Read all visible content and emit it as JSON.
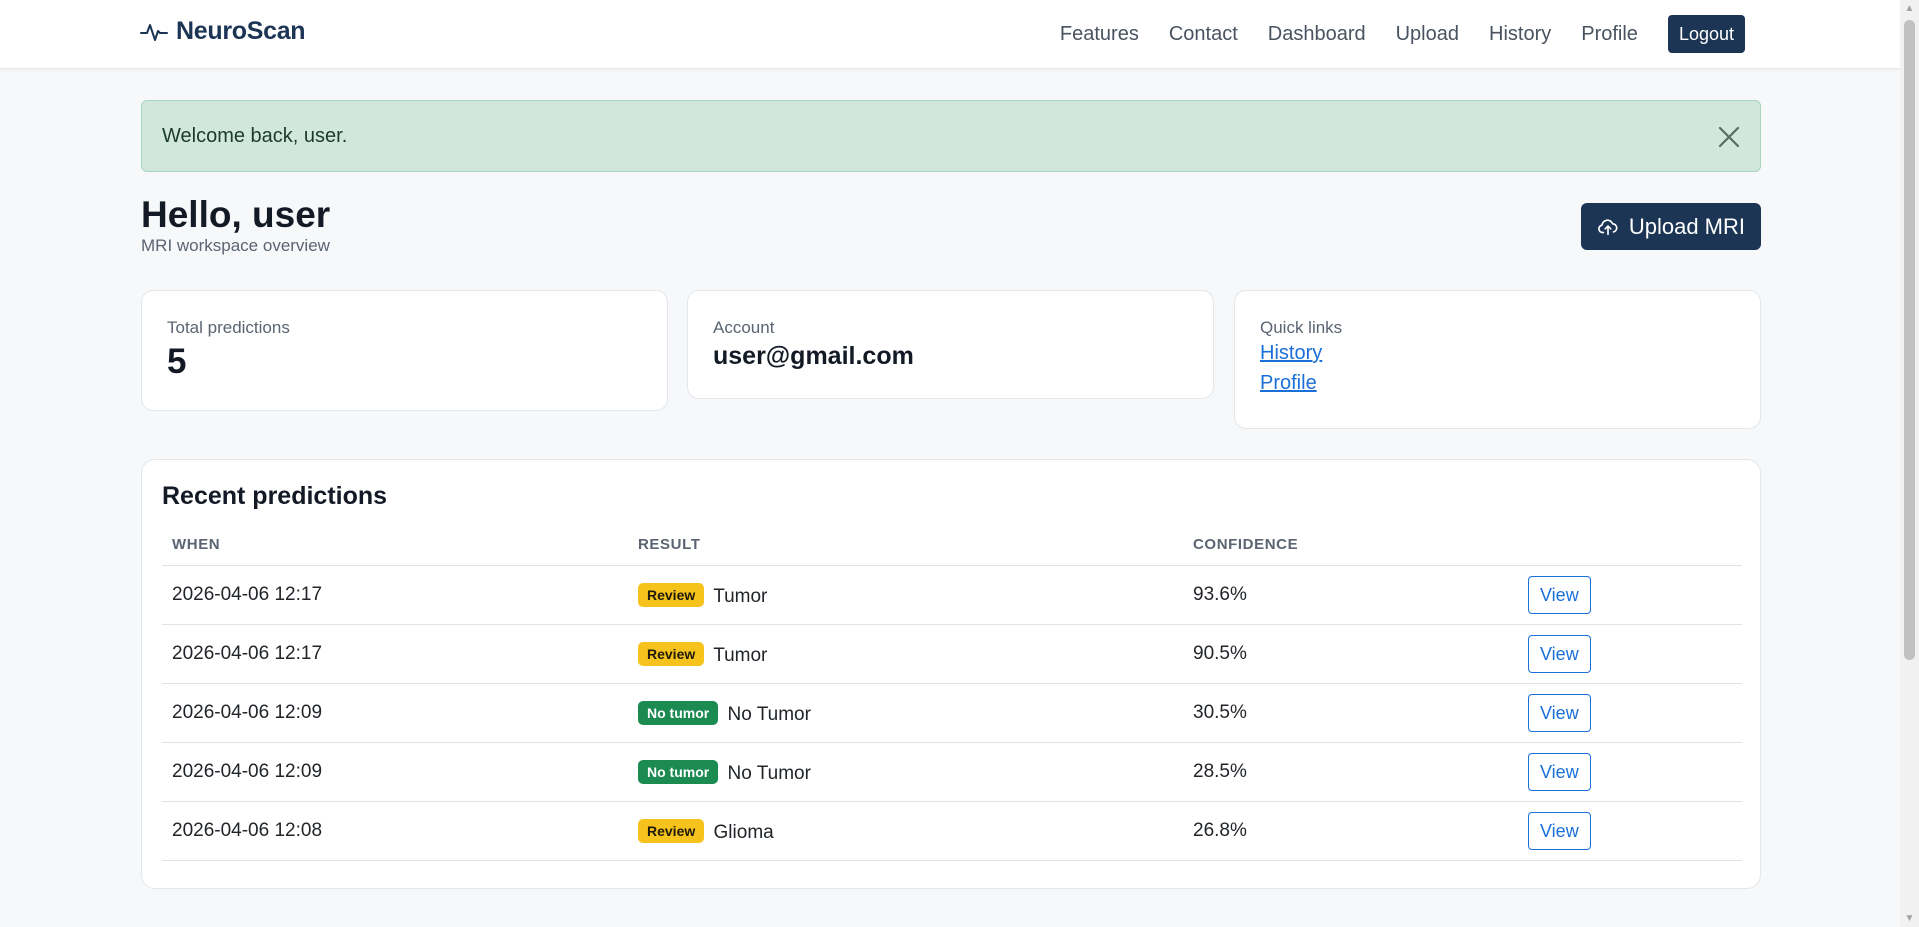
{
  "brand": {
    "name": "NeuroScan",
    "icon": "pulse-icon"
  },
  "nav": {
    "links": [
      "Features",
      "Contact",
      "Dashboard",
      "Upload",
      "History",
      "Profile"
    ],
    "logout_label": "Logout"
  },
  "alert": {
    "message": "Welcome back, user.",
    "close_icon": "close-icon"
  },
  "header": {
    "title": "Hello, user",
    "subtitle": "MRI workspace overview",
    "upload_label": "Upload MRI",
    "upload_icon": "cloud-upload-icon"
  },
  "stats": {
    "total": {
      "label": "Total predictions",
      "value": "5"
    },
    "account": {
      "label": "Account",
      "value": "user@gmail.com"
    },
    "quick_links": {
      "label": "Quick links",
      "links": [
        "History",
        "Profile"
      ]
    }
  },
  "recent": {
    "title": "Recent predictions",
    "columns": [
      "WHEN",
      "RESULT",
      "CONFIDENCE",
      ""
    ],
    "view_label": "View",
    "rows": [
      {
        "when": "2026-04-06 12:17",
        "badge": "Review",
        "badge_type": "review",
        "result": "Tumor",
        "confidence": "93.6%"
      },
      {
        "when": "2026-04-06 12:17",
        "badge": "Review",
        "badge_type": "review",
        "result": "Tumor",
        "confidence": "90.5%"
      },
      {
        "when": "2026-04-06 12:09",
        "badge": "No tumor",
        "badge_type": "ok",
        "result": "No Tumor",
        "confidence": "30.5%"
      },
      {
        "when": "2026-04-06 12:09",
        "badge": "No tumor",
        "badge_type": "ok",
        "result": "No Tumor",
        "confidence": "28.5%"
      },
      {
        "when": "2026-04-06 12:08",
        "badge": "Review",
        "badge_type": "review",
        "result": "Glioma",
        "confidence": "26.8%"
      }
    ]
  },
  "colors": {
    "brand_navy": "#1c3554",
    "success_bg": "#d1e7dd",
    "link_blue": "#1a6fd8",
    "review_yellow": "#f6c21c",
    "ok_green": "#1b8b52"
  }
}
